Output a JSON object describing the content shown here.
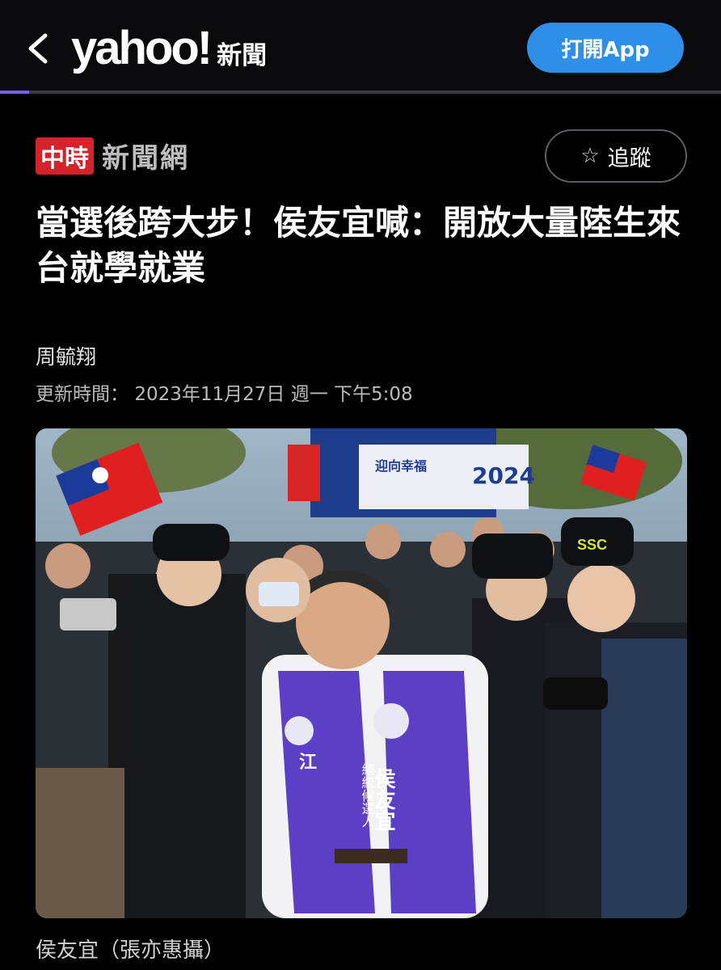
{
  "header": {
    "logo_text": "yahoo!",
    "logo_suffix": "新聞",
    "open_app_label": "打開App",
    "reading_progress": 0.04
  },
  "source": {
    "badge": "中時",
    "name": "新聞網",
    "follow_label": "追蹤"
  },
  "article": {
    "headline": "當選後跨大步！侯友宜喊：開放大量陸生來台就學就業",
    "author": "周毓翔",
    "updated_label": "更新時間：",
    "updated_value": "2023年11月27日 週一 下午5:08",
    "photo_caption": "侯友宜（張亦惠攝）",
    "photo_texts": {
      "vest_name": "侯友宜",
      "vest_title": "總統候選人",
      "vest_side": "江",
      "cap_label": "SSC",
      "sign_year": "2024",
      "sign_text": "迎向幸福"
    }
  },
  "icons": {
    "back": "chevron-left-icon",
    "follow": "star-outline-icon"
  },
  "colors": {
    "accent_blue": "#2f8fe8",
    "progress": "#7b5cff",
    "source_red": "#d4232b",
    "vest_purple": "#5b3fc4"
  }
}
